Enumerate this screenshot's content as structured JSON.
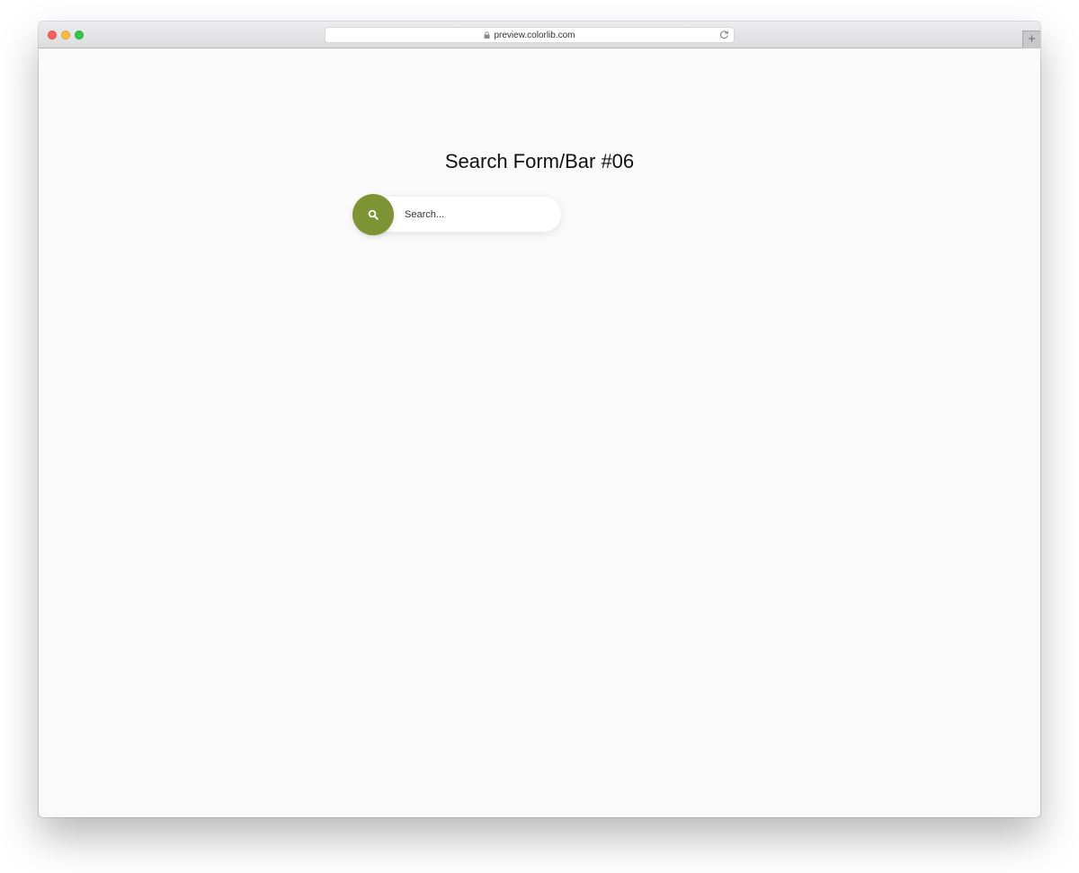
{
  "browser": {
    "url": "preview.colorlib.com",
    "new_tab_label": "+"
  },
  "page": {
    "title": "Search Form/Bar #06"
  },
  "search": {
    "placeholder": "Search...",
    "value": "",
    "button_icon": "search-icon",
    "accent_color": "#7e9434"
  }
}
